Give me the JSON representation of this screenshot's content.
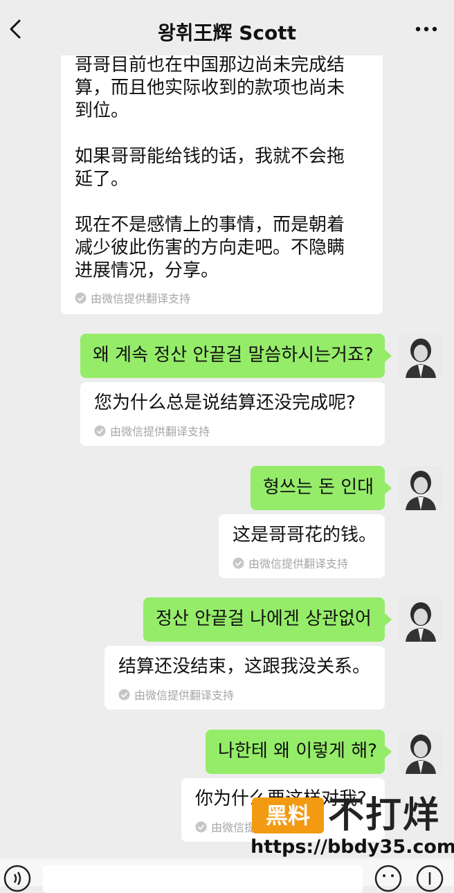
{
  "header": {
    "title": "왕휘王辉 Scott"
  },
  "messages": [
    {
      "text": "哥哥目前也在中国那边尚未完成结\n算，而且他实际收到的款项也尚未\n到位。\n\n如果哥哥能给钱的话，我就不会拖\n延了。\n\n现在不是感情上的事情，而是朝着\n减少彼此伤害的方向走吧。不隐瞒\n进展情况，分享。",
      "note": "由微信提供翻译支持"
    },
    {
      "text": "왜 계속 정산  안끝걸 말씀하시는거죠?",
      "translation": "您为什么总是说结算还没完成呢?",
      "note": "由微信提供翻译支持"
    },
    {
      "text": "형쓰는 돈 인대",
      "translation": "这是哥哥花的钱。",
      "note": "由微信提供翻译支持"
    },
    {
      "text": "정산 안끝걸  나에겐 상관없어",
      "translation": "结算还没结束，这跟我没关系。",
      "note": "由微信提供翻译支持"
    },
    {
      "text": "나한테 왜 이렇게 해?",
      "translation": "你为什么要这样对我?",
      "note": "由微信提供翻译支持"
    }
  ],
  "watermark": {
    "badge": "黑料",
    "brand": "不打烊",
    "url": "https://bbdy35.com"
  },
  "icons": [
    "back-icon",
    "more-icon",
    "check-icon",
    "voice-icon",
    "emoji-icon",
    "plus-icon"
  ],
  "colors": {
    "green_bubble": "#95ec69",
    "background": "#ededed"
  }
}
